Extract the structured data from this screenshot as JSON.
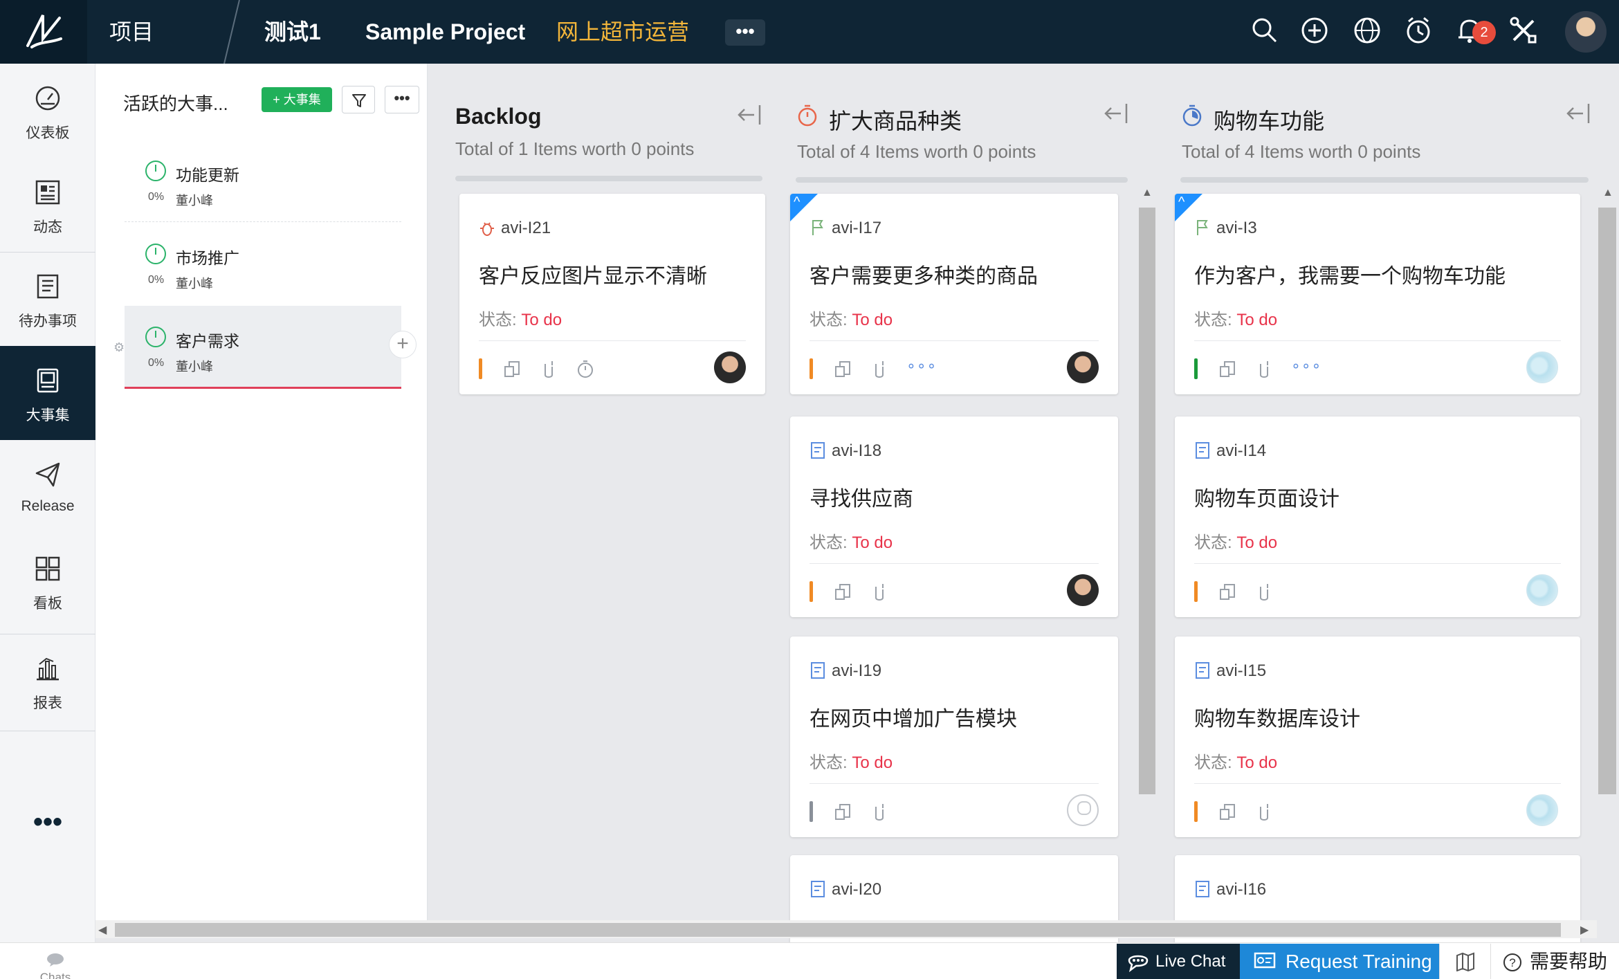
{
  "topbar": {
    "menu_projects": "项目",
    "crumb1": "测试1",
    "crumb2": "Sample Project",
    "crumb3": "网上超市运营",
    "more": "•••",
    "notification_count": "2",
    "icons": [
      "search-icon",
      "add-icon",
      "globe-icon",
      "timer-icon",
      "bell-icon",
      "tools-icon",
      "avatar"
    ]
  },
  "nav": {
    "items": [
      {
        "label": "仪表板",
        "icon": "dashboard-icon"
      },
      {
        "label": "动态",
        "icon": "feed-icon"
      },
      {
        "label": "待办事项",
        "icon": "backlog-icon"
      },
      {
        "label": "大事集",
        "icon": "epic-icon",
        "active": true
      },
      {
        "label": "Release",
        "icon": "release-icon"
      },
      {
        "label": "看板",
        "icon": "board-icon"
      },
      {
        "label": "报表",
        "icon": "report-icon"
      }
    ],
    "more": "•••"
  },
  "epics": {
    "title": "活跃的大事...",
    "add_label": "+ 大事集",
    "more": "•••",
    "list": [
      {
        "name": "功能更新",
        "pct": "0%",
        "owner": "董小峰"
      },
      {
        "name": "市场推广",
        "pct": "0%",
        "owner": "董小峰"
      },
      {
        "name": "客户需求",
        "pct": "0%",
        "owner": "董小峰",
        "selected": true
      }
    ]
  },
  "board": {
    "status_label": "状态:",
    "columns": [
      {
        "title": "Backlog",
        "subtitle": "Total of 1 Items worth 0 points",
        "cards": [
          {
            "id": "avi-I21",
            "title": "客户反应图片显示不清晰",
            "status": "To do",
            "priority_color": "#f08a24",
            "type": "bug"
          }
        ]
      },
      {
        "title": "扩大商品种类",
        "subtitle": "Total of 4 Items worth 0 points",
        "cards": [
          {
            "id": "avi-I17",
            "title": "客户需要更多种类的商品",
            "status": "To do",
            "priority_color": "#f08a24",
            "type": "story"
          },
          {
            "id": "avi-I18",
            "title": "寻找供应商",
            "status": "To do",
            "priority_color": "#f08a24",
            "type": "task"
          },
          {
            "id": "avi-I19",
            "title": "在网页中增加广告模块",
            "status": "To do",
            "priority_color": "#8a9099",
            "type": "task"
          },
          {
            "id": "avi-I20",
            "type": "task"
          }
        ]
      },
      {
        "title": "购物车功能",
        "subtitle": "Total of 4 Items worth 0 points",
        "cards": [
          {
            "id": "avi-I3",
            "title": "作为客户，我需要一个购物车功能",
            "status": "To do",
            "priority_color": "#1a9a3a",
            "type": "story"
          },
          {
            "id": "avi-I14",
            "title": "购物车页面设计",
            "status": "To do",
            "priority_color": "#f08a24",
            "type": "task"
          },
          {
            "id": "avi-I15",
            "title": "购物车数据库设计",
            "status": "To do",
            "priority_color": "#f08a24",
            "type": "task"
          },
          {
            "id": "avi-I16",
            "type": "task"
          }
        ]
      }
    ]
  },
  "bottom": {
    "chats": "Chats",
    "live_chat": "Live Chat",
    "request_training": "Request Training",
    "help": "需要帮助"
  },
  "colors": {
    "topbar": "#0f2535",
    "accent_green": "#20b05a",
    "todo_red": "#e8334a",
    "crumb_highlight": "#f2b53a",
    "request_training": "#1e88d8"
  }
}
